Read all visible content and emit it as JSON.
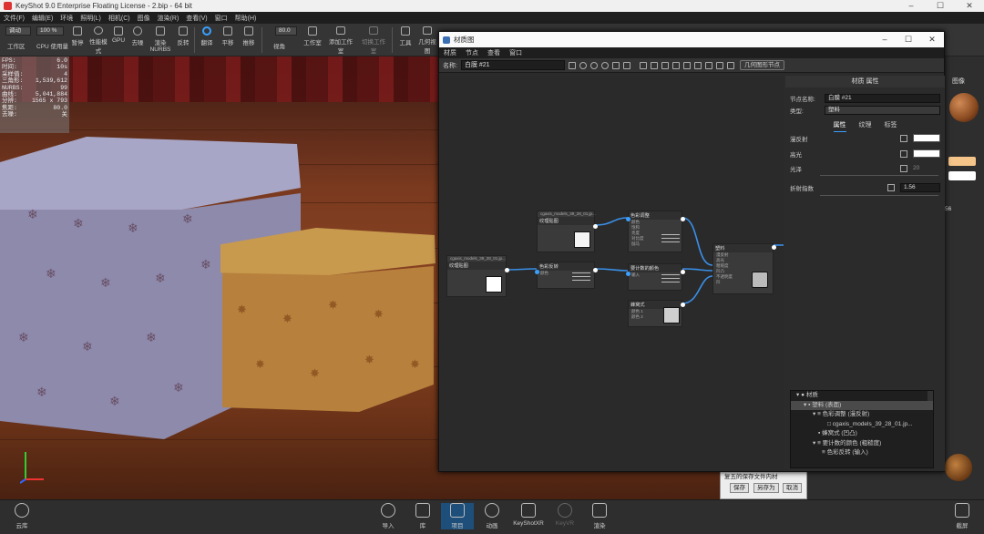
{
  "window": {
    "title": "KeyShot 9.0 Enterprise Floating License  -  2.bip  -  64 bit"
  },
  "menubar": [
    "文件(F)",
    "编辑(E)",
    "环境",
    "照明(L)",
    "相机(C)",
    "图像",
    "渲染(R)",
    "查看(V)",
    "窗口",
    "帮助(H)"
  ],
  "toolbar": {
    "mode_value": "调动",
    "zoom_value": "100 %",
    "fov_value": "80.0",
    "items": [
      "工作区",
      "CPU 使用量",
      "暂停",
      "性能模式",
      "GPU",
      "去噪",
      "渲染 NURBS",
      "反转",
      "翻译",
      "平移",
      "推移",
      "视角",
      "工作室",
      "添加工作室",
      "切换工作室",
      "工具",
      "几何视图"
    ]
  },
  "stats": [
    {
      "k": "FPS:",
      "v": "6.0"
    },
    {
      "k": "时间:",
      "v": "10s"
    },
    {
      "k": "采样值:",
      "v": "4"
    },
    {
      "k": "三角形:",
      "v": "1,539,612"
    },
    {
      "k": "NURBS:",
      "v": "99"
    },
    {
      "k": "曲线:",
      "v": "5,041,884"
    },
    {
      "k": "分辨:",
      "v": "1565 x 793"
    },
    {
      "k": "焦距:",
      "v": "80.0"
    },
    {
      "k": "去噪:",
      "v": "关"
    }
  ],
  "material_window": {
    "title": "材质图",
    "menu": [
      "材质",
      "节点",
      "查看",
      "窗口"
    ],
    "name_label": "名称:",
    "name_value": "白膜 #21",
    "geometry_node_button": "几何图形节点",
    "nodes": {
      "tex1": {
        "path": "cgaxis_models_39_28_01.jp...",
        "title": "纹理贴图"
      },
      "tex2": {
        "path": "cgaxis_models_39_28_01.jp...",
        "title": "纹理贴图"
      },
      "adjust": {
        "title": "色彩调整",
        "props": [
          "颜色",
          "饱和",
          "亮度",
          "对比度",
          "伽马"
        ]
      },
      "invert": {
        "title": "色彩反转",
        "props": [
          "颜色"
        ]
      },
      "gradient": {
        "title": "要计数的颜色",
        "props": [
          "输入"
        ]
      },
      "cell": {
        "title": "蜂窝式",
        "props": [
          "颜色 1",
          "颜色 2"
        ]
      },
      "plastic": {
        "title": "塑料",
        "props": [
          "漫反射",
          "高光",
          "粗糙度",
          "凹凸",
          "不透明度",
          "凹"
        ]
      }
    },
    "props": {
      "header": "材质 属性",
      "node_name_label": "节点名称:",
      "node_name_value": "白膜 #21",
      "type_label": "类型:",
      "type_value": "塑料",
      "tabs": [
        "属性",
        "纹理",
        "标签"
      ],
      "diffuse_label": "漫反射",
      "specular_label": "高光",
      "roughness_label": "光泽",
      "roughness_value": "20",
      "ior_label": "折射指数",
      "ior_value": "1.56"
    },
    "tree": [
      {
        "label": "材质"
      },
      {
        "label": "塑料 (表面)"
      },
      {
        "label": "色彩调整 (漫反射)"
      },
      {
        "label": "cgaxis_models_39_28_01.jp..."
      },
      {
        "label": "蜂窝式 (凹凸)"
      },
      {
        "label": "要计数的颜色 (粗糙度)"
      },
      {
        "label": "色彩反转 (输入)"
      }
    ]
  },
  "behind_dialog": {
    "text": "复五的保存文件内材",
    "save": "保存",
    "save_as": "另存为",
    "cancel": "取消"
  },
  "right_panel": {
    "image_label": "图像",
    "value": "56"
  },
  "bottombar": {
    "items": [
      {
        "label": "云库"
      },
      {
        "label": "导入"
      },
      {
        "label": "库"
      },
      {
        "label": "项目"
      },
      {
        "label": "动画"
      },
      {
        "label": "KeyShotXR"
      },
      {
        "label": "KeyVR"
      },
      {
        "label": "渲染"
      },
      {
        "label": "截屏"
      }
    ]
  }
}
